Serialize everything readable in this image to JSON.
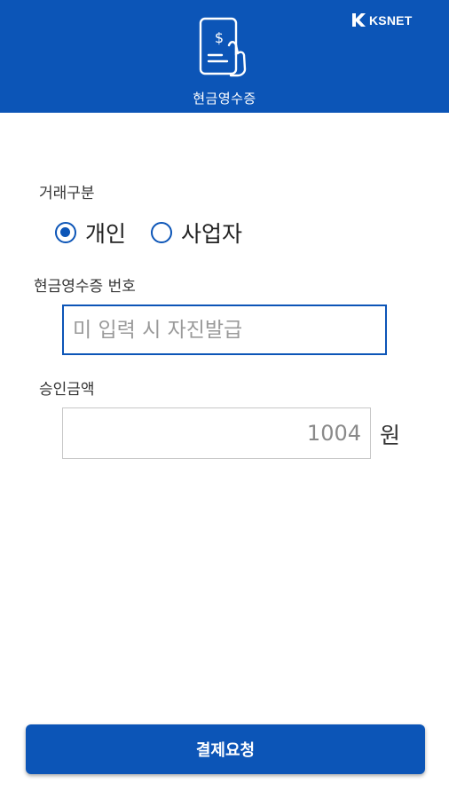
{
  "header": {
    "title": "현금영수증",
    "brand": "KSNET",
    "icon": "receipt-dollar-icon"
  },
  "form": {
    "transaction_type_label": "거래구분",
    "options": [
      {
        "label": "개인",
        "selected": true
      },
      {
        "label": "사업자",
        "selected": false
      }
    ],
    "receipt_number_label": "현금영수증 번호",
    "receipt_number_placeholder": "미 입력 시 자진발급",
    "receipt_number_value": "",
    "amount_label": "승인금액",
    "amount_value": "1004",
    "amount_unit": "원"
  },
  "actions": {
    "submit_label": "결제요청"
  },
  "colors": {
    "primary": "#0c55b7",
    "border_gray": "#c7c7c7"
  }
}
